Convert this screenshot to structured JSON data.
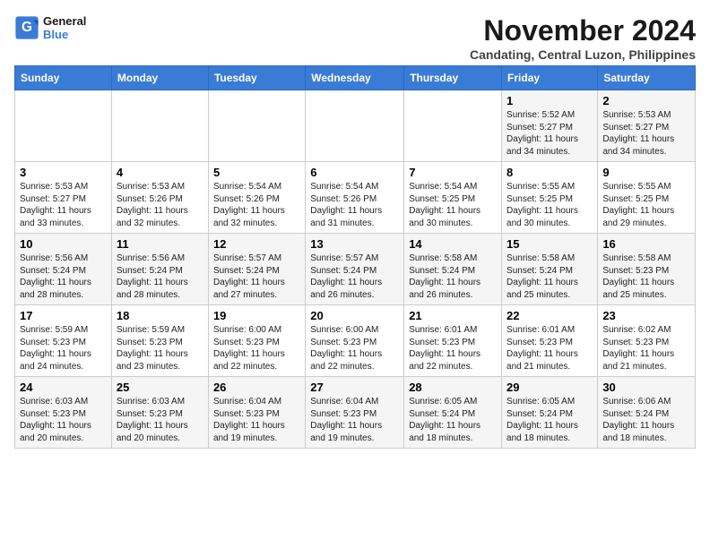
{
  "header": {
    "logo_general": "General",
    "logo_blue": "Blue",
    "month_year": "November 2024",
    "location": "Candating, Central Luzon, Philippines"
  },
  "columns": [
    "Sunday",
    "Monday",
    "Tuesday",
    "Wednesday",
    "Thursday",
    "Friday",
    "Saturday"
  ],
  "weeks": [
    [
      {
        "day": "",
        "detail": ""
      },
      {
        "day": "",
        "detail": ""
      },
      {
        "day": "",
        "detail": ""
      },
      {
        "day": "",
        "detail": ""
      },
      {
        "day": "",
        "detail": ""
      },
      {
        "day": "1",
        "detail": "Sunrise: 5:52 AM\nSunset: 5:27 PM\nDaylight: 11 hours and 34 minutes."
      },
      {
        "day": "2",
        "detail": "Sunrise: 5:53 AM\nSunset: 5:27 PM\nDaylight: 11 hours and 34 minutes."
      }
    ],
    [
      {
        "day": "3",
        "detail": "Sunrise: 5:53 AM\nSunset: 5:27 PM\nDaylight: 11 hours and 33 minutes."
      },
      {
        "day": "4",
        "detail": "Sunrise: 5:53 AM\nSunset: 5:26 PM\nDaylight: 11 hours and 32 minutes."
      },
      {
        "day": "5",
        "detail": "Sunrise: 5:54 AM\nSunset: 5:26 PM\nDaylight: 11 hours and 32 minutes."
      },
      {
        "day": "6",
        "detail": "Sunrise: 5:54 AM\nSunset: 5:26 PM\nDaylight: 11 hours and 31 minutes."
      },
      {
        "day": "7",
        "detail": "Sunrise: 5:54 AM\nSunset: 5:25 PM\nDaylight: 11 hours and 30 minutes."
      },
      {
        "day": "8",
        "detail": "Sunrise: 5:55 AM\nSunset: 5:25 PM\nDaylight: 11 hours and 30 minutes."
      },
      {
        "day": "9",
        "detail": "Sunrise: 5:55 AM\nSunset: 5:25 PM\nDaylight: 11 hours and 29 minutes."
      }
    ],
    [
      {
        "day": "10",
        "detail": "Sunrise: 5:56 AM\nSunset: 5:24 PM\nDaylight: 11 hours and 28 minutes."
      },
      {
        "day": "11",
        "detail": "Sunrise: 5:56 AM\nSunset: 5:24 PM\nDaylight: 11 hours and 28 minutes."
      },
      {
        "day": "12",
        "detail": "Sunrise: 5:57 AM\nSunset: 5:24 PM\nDaylight: 11 hours and 27 minutes."
      },
      {
        "day": "13",
        "detail": "Sunrise: 5:57 AM\nSunset: 5:24 PM\nDaylight: 11 hours and 26 minutes."
      },
      {
        "day": "14",
        "detail": "Sunrise: 5:58 AM\nSunset: 5:24 PM\nDaylight: 11 hours and 26 minutes."
      },
      {
        "day": "15",
        "detail": "Sunrise: 5:58 AM\nSunset: 5:24 PM\nDaylight: 11 hours and 25 minutes."
      },
      {
        "day": "16",
        "detail": "Sunrise: 5:58 AM\nSunset: 5:23 PM\nDaylight: 11 hours and 25 minutes."
      }
    ],
    [
      {
        "day": "17",
        "detail": "Sunrise: 5:59 AM\nSunset: 5:23 PM\nDaylight: 11 hours and 24 minutes."
      },
      {
        "day": "18",
        "detail": "Sunrise: 5:59 AM\nSunset: 5:23 PM\nDaylight: 11 hours and 23 minutes."
      },
      {
        "day": "19",
        "detail": "Sunrise: 6:00 AM\nSunset: 5:23 PM\nDaylight: 11 hours and 22 minutes."
      },
      {
        "day": "20",
        "detail": "Sunrise: 6:00 AM\nSunset: 5:23 PM\nDaylight: 11 hours and 22 minutes."
      },
      {
        "day": "21",
        "detail": "Sunrise: 6:01 AM\nSunset: 5:23 PM\nDaylight: 11 hours and 22 minutes."
      },
      {
        "day": "22",
        "detail": "Sunrise: 6:01 AM\nSunset: 5:23 PM\nDaylight: 11 hours and 21 minutes."
      },
      {
        "day": "23",
        "detail": "Sunrise: 6:02 AM\nSunset: 5:23 PM\nDaylight: 11 hours and 21 minutes."
      }
    ],
    [
      {
        "day": "24",
        "detail": "Sunrise: 6:03 AM\nSunset: 5:23 PM\nDaylight: 11 hours and 20 minutes."
      },
      {
        "day": "25",
        "detail": "Sunrise: 6:03 AM\nSunset: 5:23 PM\nDaylight: 11 hours and 20 minutes."
      },
      {
        "day": "26",
        "detail": "Sunrise: 6:04 AM\nSunset: 5:23 PM\nDaylight: 11 hours and 19 minutes."
      },
      {
        "day": "27",
        "detail": "Sunrise: 6:04 AM\nSunset: 5:23 PM\nDaylight: 11 hours and 19 minutes."
      },
      {
        "day": "28",
        "detail": "Sunrise: 6:05 AM\nSunset: 5:24 PM\nDaylight: 11 hours and 18 minutes."
      },
      {
        "day": "29",
        "detail": "Sunrise: 6:05 AM\nSunset: 5:24 PM\nDaylight: 11 hours and 18 minutes."
      },
      {
        "day": "30",
        "detail": "Sunrise: 6:06 AM\nSunset: 5:24 PM\nDaylight: 11 hours and 18 minutes."
      }
    ]
  ]
}
